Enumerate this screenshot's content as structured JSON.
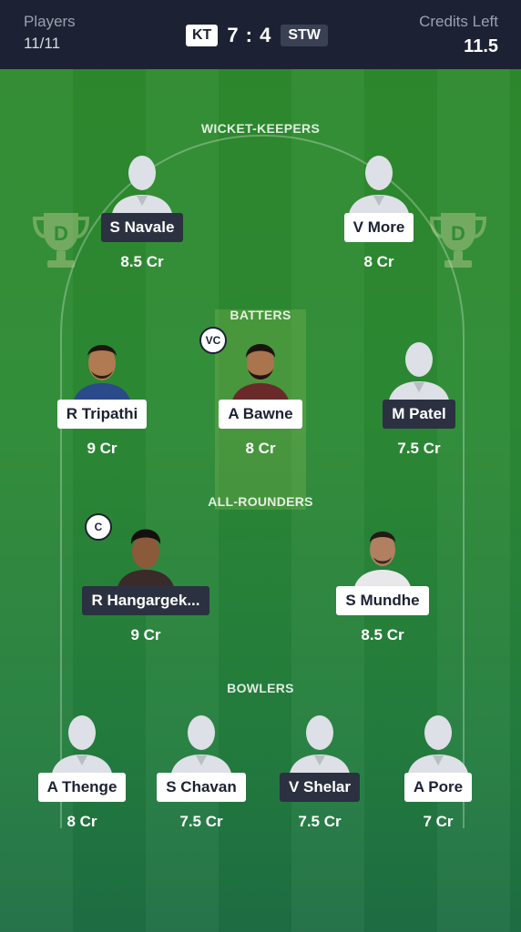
{
  "header": {
    "players_label": "Players",
    "players_value": "11/11",
    "team_a": "KT",
    "score": "7 : 4",
    "team_b": "STW",
    "credits_label": "Credits Left",
    "credits_value": "11.5"
  },
  "sections": {
    "wicket_keepers": "WICKET-KEEPERS",
    "batters": "BATTERS",
    "all_rounders": "ALL-ROUNDERS",
    "bowlers": "BOWLERS"
  },
  "players": [
    {
      "name": "S Navale",
      "credit": "8.5 Cr",
      "team": "STW"
    },
    {
      "name": "V More",
      "credit": "8 Cr",
      "team": "KT"
    },
    {
      "name": "R Tripathi",
      "credit": "9 Cr",
      "team": "KT"
    },
    {
      "name": "A Bawne",
      "credit": "8 Cr",
      "team": "KT",
      "badge": "VC"
    },
    {
      "name": "M Patel",
      "credit": "7.5 Cr",
      "team": "STW"
    },
    {
      "name": "R Hangargek...",
      "credit": "9 Cr",
      "team": "STW",
      "badge": "C"
    },
    {
      "name": "S Mundhe",
      "credit": "8.5 Cr",
      "team": "KT"
    },
    {
      "name": "A Thenge",
      "credit": "8 Cr",
      "team": "KT"
    },
    {
      "name": "S Chavan",
      "credit": "7.5 Cr",
      "team": "KT"
    },
    {
      "name": "V Shelar",
      "credit": "7.5 Cr",
      "team": "STW"
    },
    {
      "name": "A Pore",
      "credit": "7 Cr",
      "team": "KT"
    }
  ],
  "colors": {
    "header_bg": "#1c2233",
    "field_green": "#2c8a34",
    "chip_dark": "#2b3140"
  }
}
